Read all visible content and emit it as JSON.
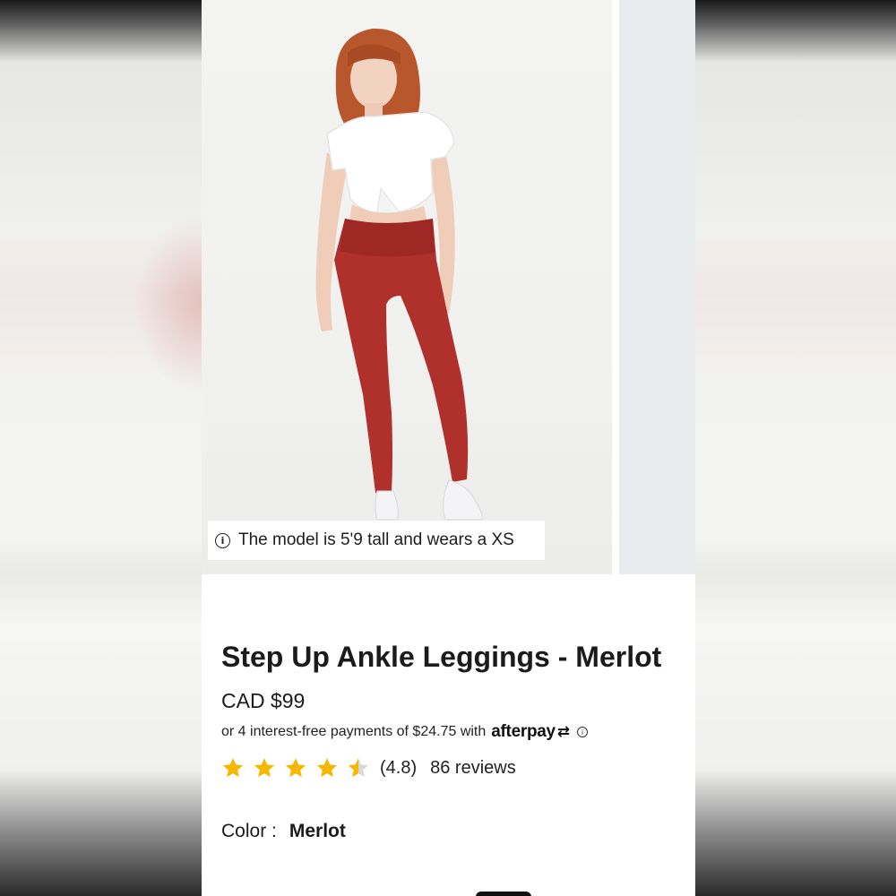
{
  "product": {
    "image_caption": "The model is 5'9 tall and wears a XS",
    "title": "Step Up Ankle Leggings - Merlot",
    "price": "CAD $99",
    "afterpay": {
      "text": "or 4 interest-free payments of $24.75 with",
      "brand": "afterpay",
      "info_icon": "info-icon"
    },
    "rating": {
      "stars": 4.5,
      "value": "(4.8)",
      "reviews": "86 reviews"
    },
    "color": {
      "label": "Color :",
      "value": "Merlot"
    }
  },
  "colors": {
    "star": "#f5b800",
    "star_empty": "#d9d9d9",
    "leggings": "#b0302c",
    "text": "#1b1b1b"
  }
}
